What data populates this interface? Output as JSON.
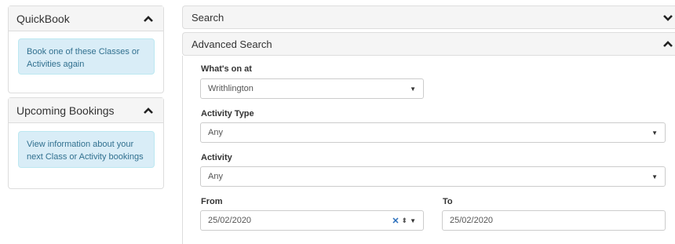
{
  "sidebar": {
    "quickbook": {
      "title": "QuickBook",
      "info": "Book one of these Classes or Activities again"
    },
    "upcoming": {
      "title": "Upcoming Bookings",
      "info": "View information about your next Class or Activity bookings"
    }
  },
  "main": {
    "search_title": "Search",
    "advanced_title": "Advanced Search",
    "whats_on": {
      "label": "What's on at",
      "value": "Writhlington"
    },
    "activity_type": {
      "label": "Activity Type",
      "value": "Any"
    },
    "activity": {
      "label": "Activity",
      "value": "Any"
    },
    "from": {
      "label": "From",
      "value": "25/02/2020"
    },
    "to": {
      "label": "To",
      "value": "25/02/2020"
    }
  },
  "icons": {
    "collapse": "chevron-up-icon",
    "expand": "chevron-down-icon",
    "clear": "clear-x-icon",
    "spinner": "spinner-icon",
    "dropdown": "caret-down-icon"
  }
}
